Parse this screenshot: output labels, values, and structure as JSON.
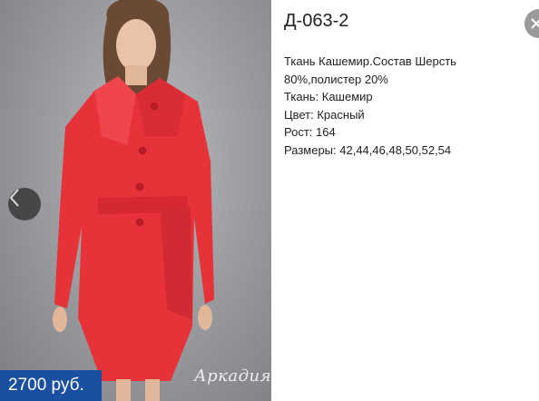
{
  "product": {
    "title": "Д-063-2",
    "description_lines": [
      "Ткань Кашемир.Состав Шерсть",
      "80%,полистер 20%",
      "Ткань: Кашемир",
      "Цвет: Красный",
      "Рост: 164",
      "Размеры: 42,44,46,48,50,52,54"
    ],
    "price": "2700 руб.",
    "watermark": "Аркадия"
  },
  "icons": {
    "prev": "chevron-left-icon",
    "close": "close-icon"
  },
  "colors": {
    "price_tag_bg": "#1b4fa0",
    "coat": "#e8323a",
    "backdrop": "#9c9ea1",
    "close_button": "#9a9a9a"
  }
}
